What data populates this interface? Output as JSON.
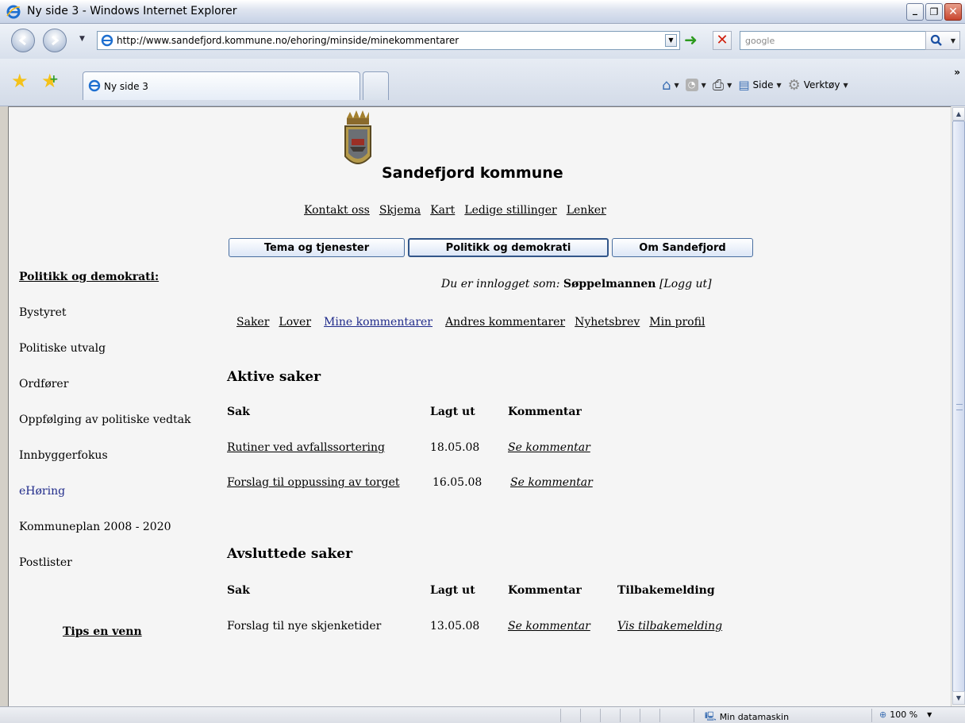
{
  "window": {
    "title": "Ny side 3 - Windows Internet Explorer",
    "buttons": {
      "minimize": "_",
      "maximize": "❐",
      "close": "✕"
    }
  },
  "address_bar": {
    "url": "http://www.sandefjord.kommune.no/ehoring/minside/minekommentarer",
    "search_placeholder": "google"
  },
  "tabs": [
    {
      "label": "Ny side 3"
    }
  ],
  "command_bar": {
    "page_label": "Side",
    "tools_label": "Verktøy"
  },
  "site": {
    "title": "Sandefjord kommune",
    "top_links": [
      "Kontakt oss",
      "Skjema",
      "Kart",
      "Ledige stillinger",
      "Lenker"
    ],
    "main_nav": [
      "Tema og tjenester",
      "Politikk og demokrati",
      "Om Sandefjord"
    ],
    "main_nav_active": "Politikk og demokrati"
  },
  "sidebar": {
    "heading": "Politikk og demokrati:",
    "items": [
      "Bystyret",
      "Politiske utvalg",
      "Ordfører",
      "Oppfølging av politiske vedtak",
      "Innbyggerfokus",
      "eHøring",
      "Kommuneplan 2008 - 2020",
      "Postlister"
    ],
    "current": "eHøring",
    "tips": "Tips en venn"
  },
  "login": {
    "prefix": "Du er innlogget som:",
    "user": "Søppelmannen",
    "logout": "[Logg ut]"
  },
  "sub_nav": [
    "Saker",
    "Lover",
    "Mine kommentarer",
    "Andres kommentarer",
    "Nyhetsbrev",
    "Min profil"
  ],
  "sub_nav_current": "Mine kommentarer",
  "active_cases": {
    "heading": "Aktive saker",
    "columns": [
      "Sak",
      "Lagt ut",
      "Kommentar"
    ],
    "rows": [
      {
        "sak": "Rutiner ved avfallssortering",
        "lagt_ut": "18.05.08",
        "kommentar": "Se kommentar"
      },
      {
        "sak": "Forslag til oppussing av torget",
        "lagt_ut": "16.05.08",
        "kommentar": "Se kommentar"
      }
    ]
  },
  "closed_cases": {
    "heading": "Avsluttede saker",
    "columns": [
      "Sak",
      "Lagt ut",
      "Kommentar",
      "Tilbakemelding"
    ],
    "rows": [
      {
        "sak": "Forslag til nye skjenketider",
        "lagt_ut": "13.05.08",
        "kommentar": "Se kommentar",
        "tilbakemelding": "Vis tilbakemelding"
      }
    ]
  },
  "status_bar": {
    "zone": "Min datamaskin",
    "zoom": "100 %"
  },
  "colors": {
    "link_visited": "#1f2a8a",
    "nav_button_border": "#4a6fa0"
  }
}
